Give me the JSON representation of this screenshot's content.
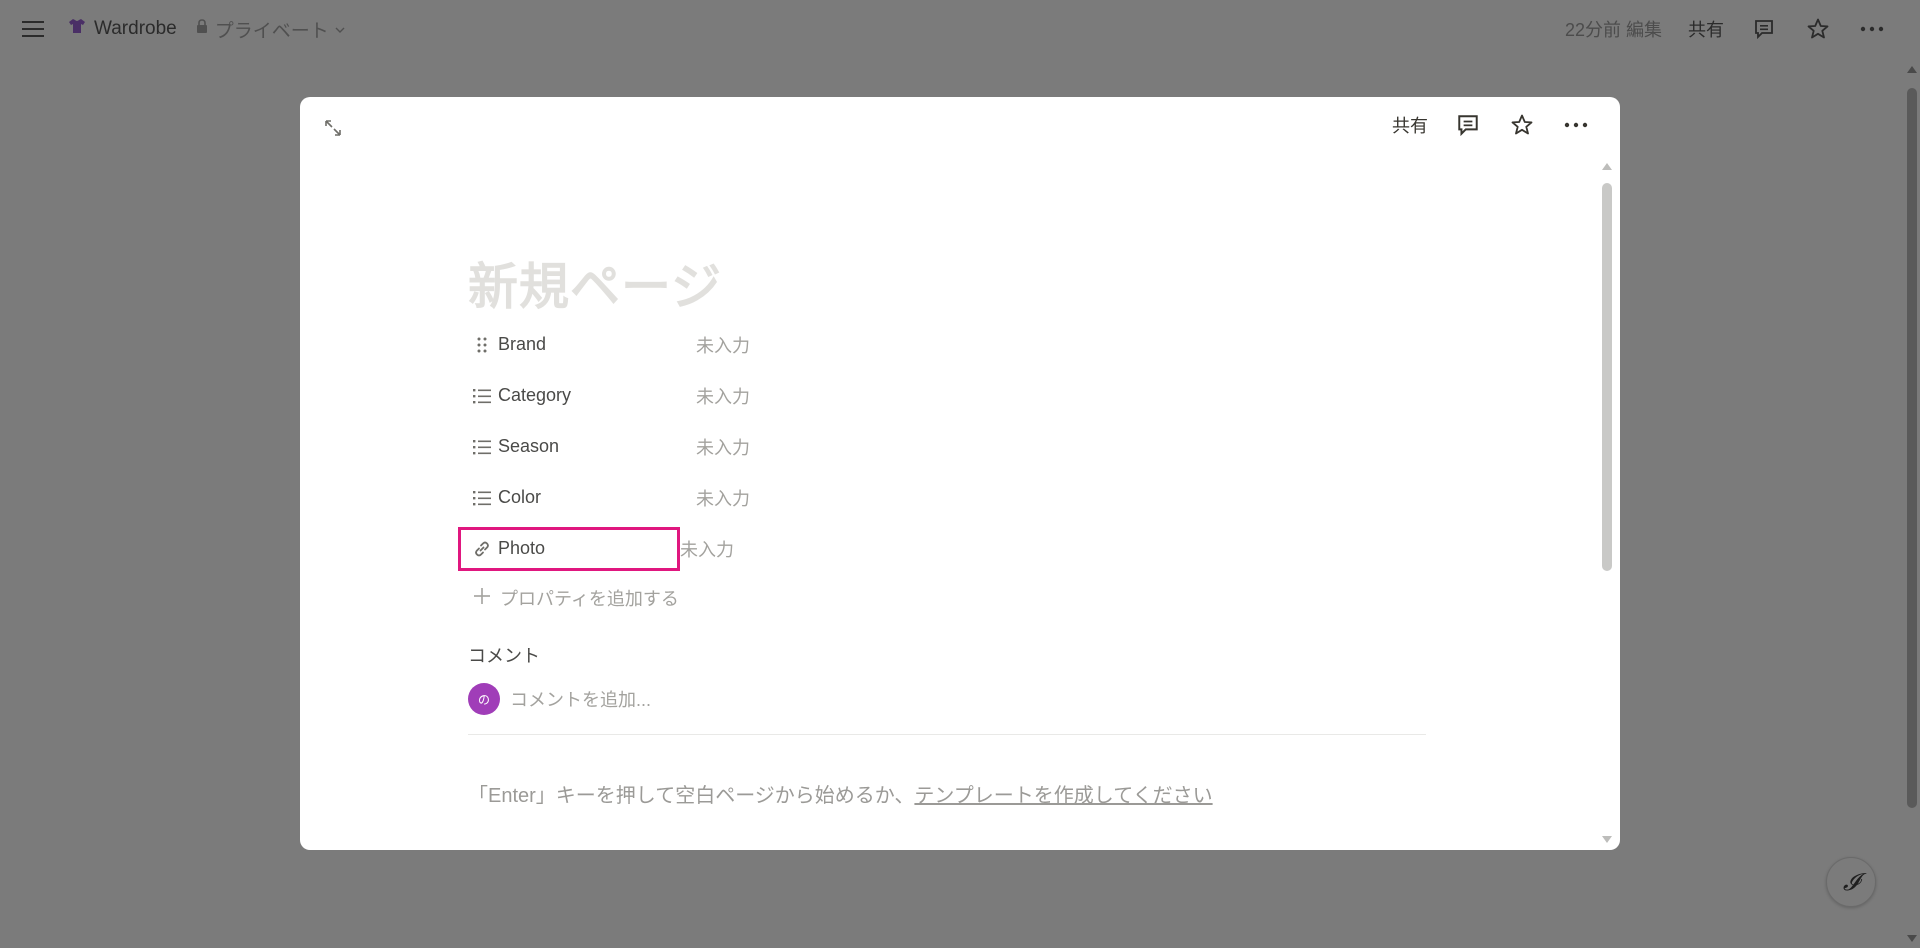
{
  "topbar": {
    "workspace_title": "Wardrobe",
    "privacy_label": "プライベート",
    "edited": "22分前 編集",
    "share_label": "共有",
    "icons": [
      "menu-icon",
      "tshirt-icon",
      "lock-icon",
      "chevron-down-icon",
      "comment-icon",
      "star-icon",
      "more-icon"
    ]
  },
  "modal": {
    "share_label": "共有",
    "page_title_placeholder": "新規ページ",
    "properties": [
      {
        "name": "Brand",
        "value": "未入力",
        "icon": "drag-handle-icon"
      },
      {
        "name": "Category",
        "value": "未入力",
        "icon": "list-icon"
      },
      {
        "name": "Season",
        "value": "未入力",
        "icon": "list-icon"
      },
      {
        "name": "Color",
        "value": "未入力",
        "icon": "list-icon"
      },
      {
        "name": "Photo",
        "value": "未入力",
        "icon": "link-icon"
      }
    ],
    "add_property": "プロパティを追加する",
    "comments_label": "コメント",
    "avatar_text": "の",
    "comment_placeholder": "コメントを追加...",
    "hint_prefix": "「Enter」キーを押して空白ページから始めるか、",
    "hint_link": "テンプレートを作成してください"
  },
  "colors": {
    "overlay": "#7b7b7b",
    "highlight": "#e0177f",
    "avatar": "#a03db8"
  }
}
